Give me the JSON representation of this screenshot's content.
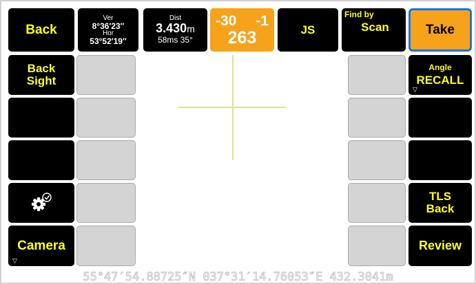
{
  "top_bar": {
    "back": "Back",
    "ver_label": "Ver",
    "ver_value": "8°36′23″",
    "hor_label": "Hor",
    "hor_value": "53°52′19″",
    "dist_label": "Dist",
    "dist_value": "3.430",
    "dist_unit": "m",
    "dist_sub": "58ms 35°",
    "orange_top_left": "-30",
    "orange_top_right": "-1",
    "orange_bottom": "263",
    "js": "JS",
    "find_by": "Find by",
    "scan": "Scan",
    "take": "Take"
  },
  "left_column": {
    "back_sight": "Back Sight",
    "camera": "Camera"
  },
  "right_column": {
    "angle": "Angle",
    "recall": "RECALL",
    "tls_back": "TLS Back",
    "review": "Review"
  },
  "icons": {
    "settings": "gear-check-icon",
    "dropdown": "triangle-down-icon"
  },
  "status_bar": {
    "coordinates": "55°47′54.88725″N 037°31′14.76053″E 432.3041m"
  },
  "colors": {
    "button_bg": "#000000",
    "text_yellow": "#ffff22",
    "orange": "#f7a21b",
    "take_border": "#1e6fe6",
    "crosshair": "#e2e18a",
    "gray_cell": "#d4d4d4"
  }
}
